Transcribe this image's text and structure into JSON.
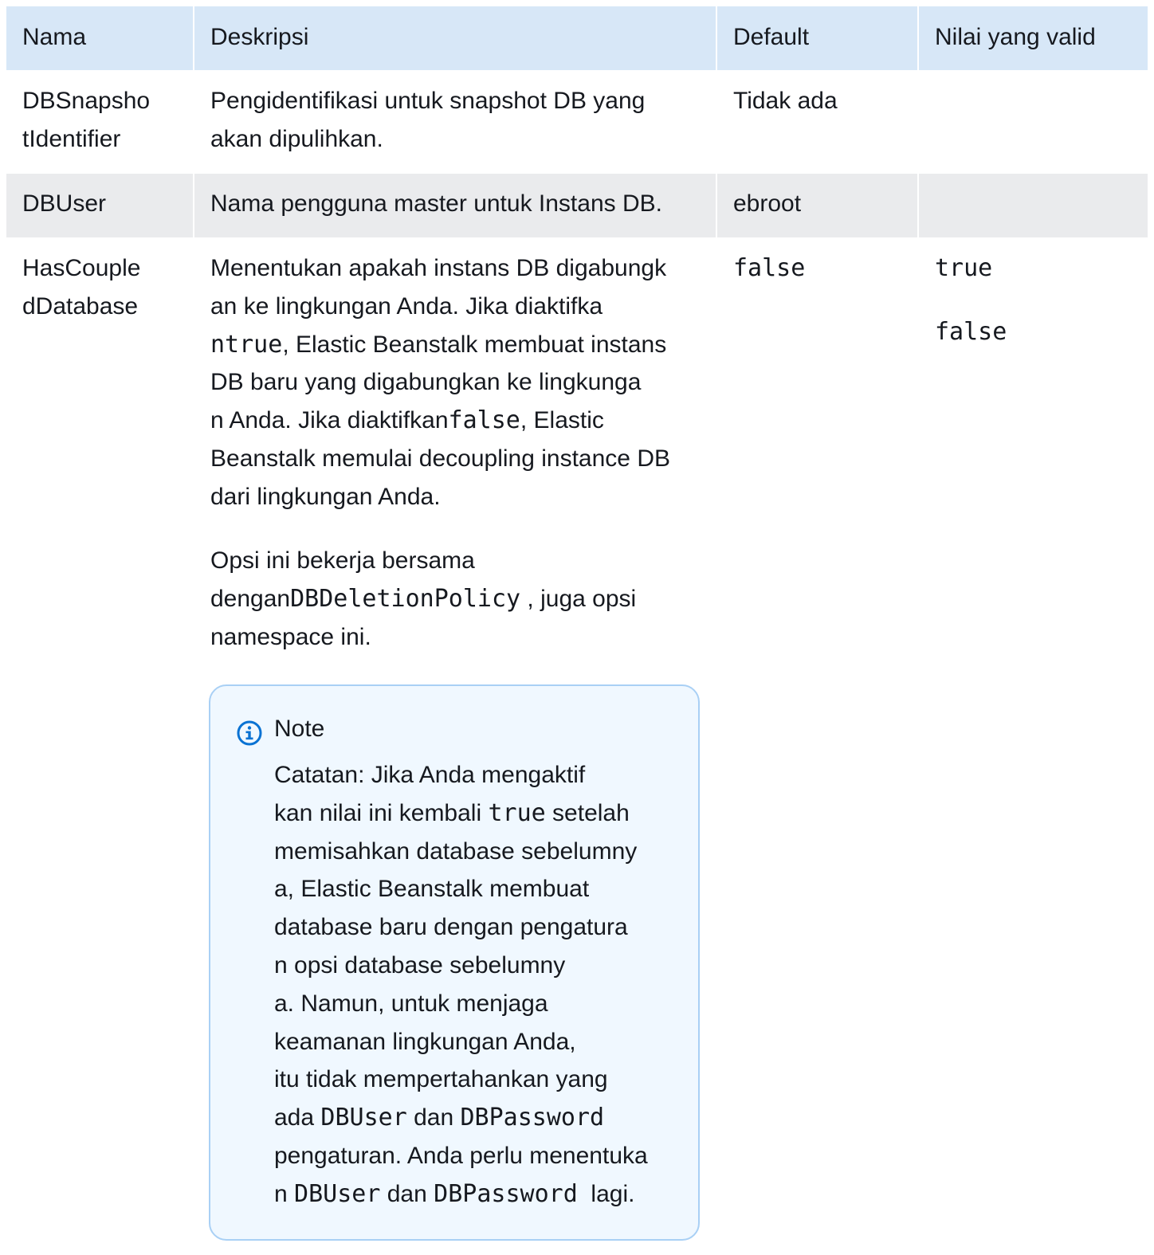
{
  "headers": {
    "name": "Nama",
    "description": "Deskripsi",
    "default": "Default",
    "valid_values": "Nilai yang valid"
  },
  "rows": [
    {
      "name_line1": "DBSnapsho",
      "name_line2": "tIdentifier",
      "desc_line1": "Pengidentifikasi untuk snapshot DB yang",
      "desc_line2": "akan dipulihkan.",
      "default": "Tidak ada",
      "valid": ""
    },
    {
      "name": "DBUser",
      "desc": "Nama pengguna master untuk Instans DB.",
      "default": "ebroot",
      "valid": ""
    },
    {
      "name_line1": "HasCouple",
      "name_line2": "dDatabase",
      "desc_p1": {
        "l1": "Menentukan apakah instans DB digabungk",
        "l2": "an ke lingkungan Anda. Jika diaktifka",
        "l3_code": "ntrue",
        "l3_text": ", Elastic Beanstalk membuat instans",
        "l4": "DB baru yang digabungkan ke lingkunga",
        "l5_text": "n Anda. Jika diaktifkan",
        "l5_code": "false",
        "l5_tail": ", Elastic",
        "l6": "Beanstalk memulai decoupling instance DB",
        "l7": "dari lingkungan Anda."
      },
      "desc_p2": {
        "l1": "Opsi ini bekerja bersama",
        "l2_text": "dengan",
        "l2_code": "DBDeletionPolicy",
        "l2_tail": " , juga opsi",
        "l3": "namespace ini."
      },
      "default": "false",
      "valid_1": "true",
      "valid_2": "false"
    }
  ],
  "note": {
    "icon": "info-icon",
    "title": "Note",
    "l1": "Catatan: Jika Anda mengaktif",
    "l2_text": "kan nilai ini kembali ",
    "l2_code": "true",
    "l2_tail": " setelah",
    "l3": "memisahkan database sebelumny",
    "l4": "a, Elastic Beanstalk membuat",
    "l5": "database baru dengan pengatura",
    "l6": "n opsi database sebelumny",
    "l7": "a. Namun, untuk menjaga",
    "l8": "keamanan lingkungan Anda,",
    "l9": "itu tidak mempertahankan yang",
    "l10_text": "ada ",
    "l10_code1": "DBUser",
    "l10_mid": " dan ",
    "l10_code2": "DBPassword",
    "l11": "pengaturan. Anda perlu menentuka",
    "l12_text": "n ",
    "l12_code1": "DBUser",
    "l12_mid": " dan ",
    "l12_code2": "DBPassword",
    "l12_tail": "  lagi."
  },
  "colors": {
    "header_bg": "#d7e7f7",
    "alt_row_bg": "#eaebed",
    "note_bg": "#f0f8ff",
    "note_border": "#a9d0f5",
    "info_icon": "#0972d3"
  }
}
